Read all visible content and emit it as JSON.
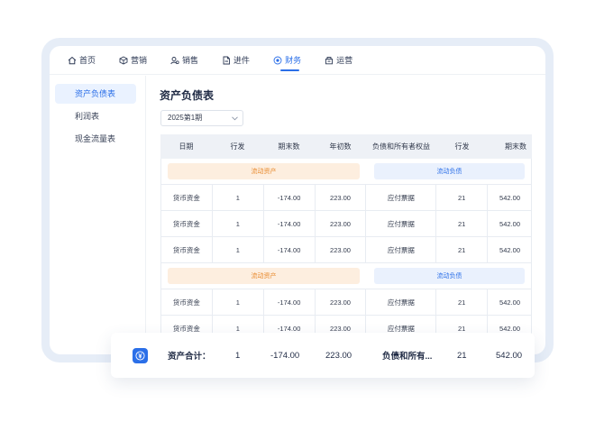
{
  "nav": {
    "items": [
      {
        "label": "首页",
        "icon": "home-icon"
      },
      {
        "label": "营销",
        "icon": "cube-icon"
      },
      {
        "label": "销售",
        "icon": "user-sales-icon"
      },
      {
        "label": "进件",
        "icon": "document-icon"
      },
      {
        "label": "财务",
        "icon": "finance-icon",
        "active": true
      },
      {
        "label": "运营",
        "icon": "operations-icon"
      }
    ]
  },
  "sidebar": {
    "items": [
      {
        "label": "资产负债表",
        "active": true
      },
      {
        "label": "利润表"
      },
      {
        "label": "现金流量表"
      }
    ]
  },
  "main": {
    "title": "资产负债表",
    "period": "2025第1期"
  },
  "table": {
    "headers": [
      "日期",
      "行发",
      "期末数",
      "年初数",
      "负债和所有者权益",
      "行发",
      "期末数"
    ],
    "section_asset": "流动资产",
    "section_liability": "流动负债",
    "rows": [
      [
        "货币资金",
        "1",
        "-174.00",
        "223.00",
        "应付票据",
        "21",
        "542.00"
      ],
      [
        "货币资金",
        "1",
        "-174.00",
        "223.00",
        "应付票据",
        "21",
        "542.00"
      ],
      [
        "货币资金",
        "1",
        "-174.00",
        "223.00",
        "应付票据",
        "21",
        "542.00"
      ],
      [
        "货币资金",
        "1",
        "-174.00",
        "223.00",
        "应付票据",
        "21",
        "542.00"
      ],
      [
        "货币资金",
        "1",
        "-174.00",
        "223.00",
        "应付票据",
        "21",
        "542.00"
      ]
    ]
  },
  "summary": {
    "label": "资产合计：",
    "line": "1",
    "end": "-174.00",
    "start": "223.00",
    "liab_label": "负债和所有...",
    "liab_line": "21",
    "liab_end": "542.00"
  },
  "colors": {
    "accent": "#2b6fe8",
    "asset_badge_bg": "#fdeedf",
    "asset_badge_text": "#e88a2e",
    "liab_badge_bg": "#eaf1fd"
  }
}
